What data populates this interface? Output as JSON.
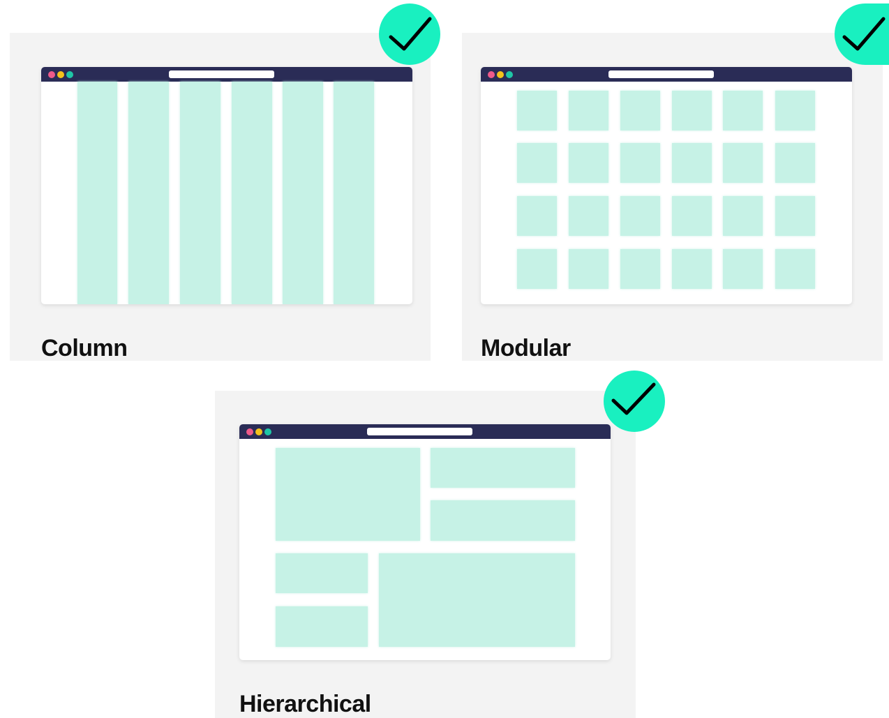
{
  "colors": {
    "titlebar": "#2a2c56",
    "block": "#c6f2e6",
    "badge": "#19f0c0",
    "dot_red": "#ef5a8a",
    "dot_yellow": "#f4c21b",
    "dot_green": "#1fc6a6"
  },
  "cards": [
    {
      "title": "Column",
      "badge_icon": "checkmark-icon"
    },
    {
      "title": "Modular",
      "badge_icon": "checkmark-icon"
    },
    {
      "title": "Hierarchical",
      "badge_icon": "checkmark-icon"
    }
  ]
}
